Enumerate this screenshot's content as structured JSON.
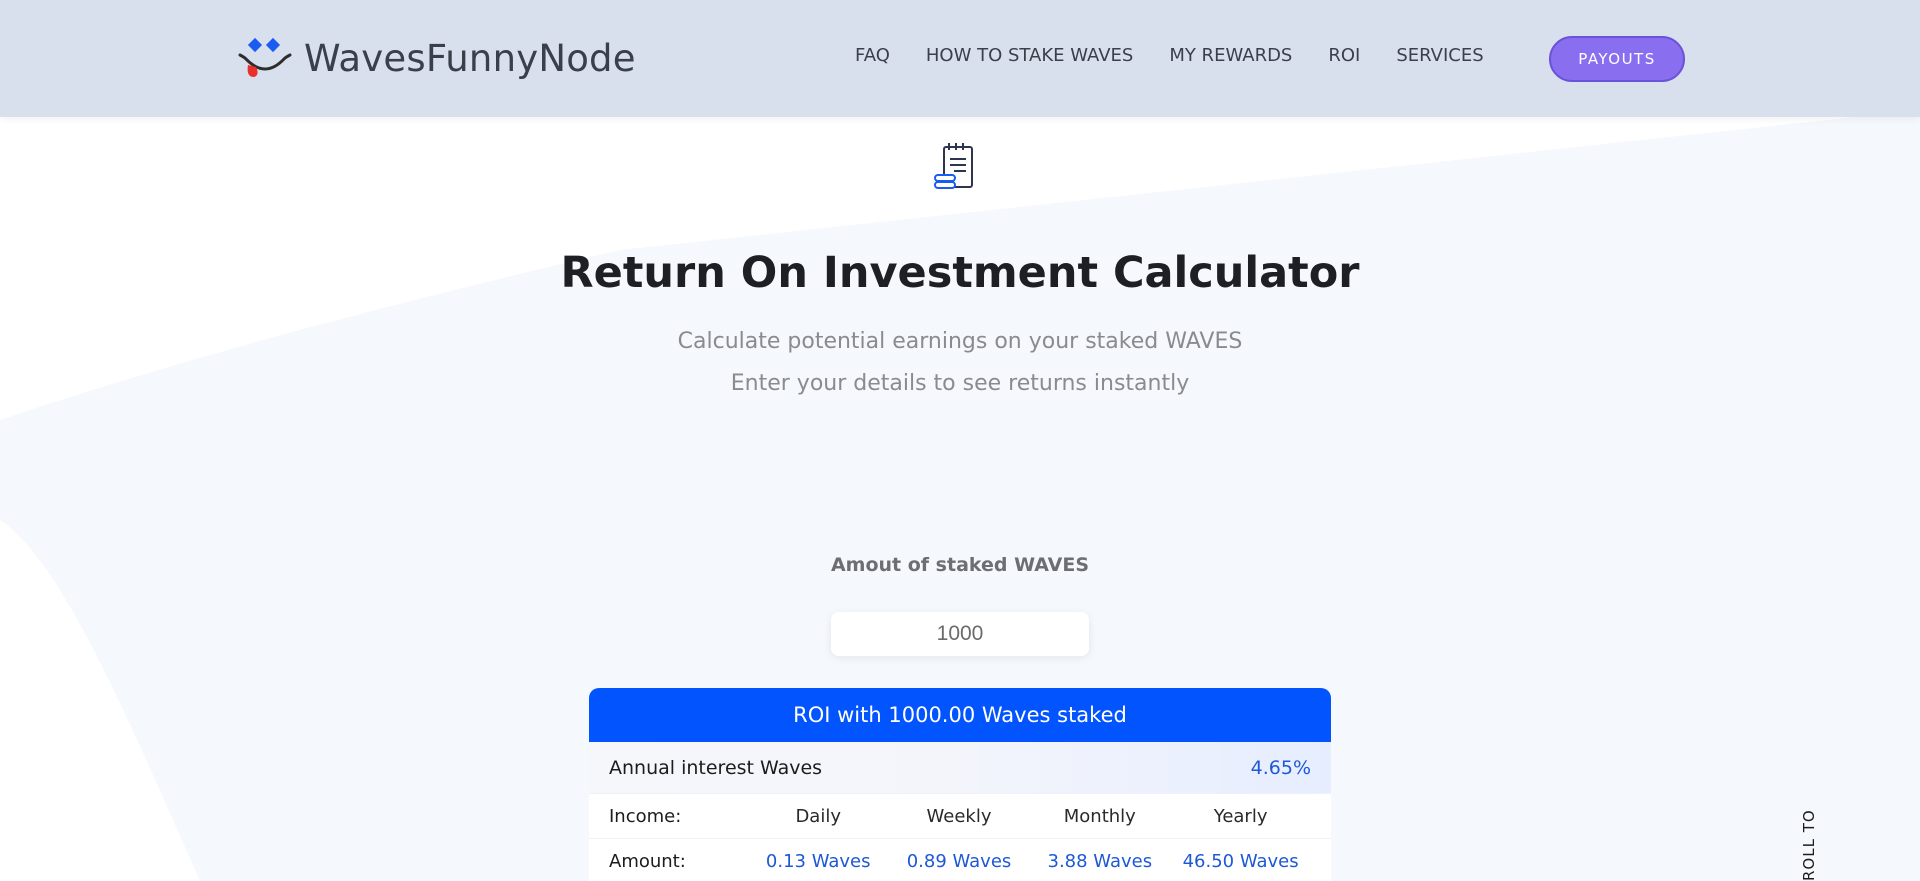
{
  "brand": {
    "name": "WavesFunnyNode",
    "logo_icon": "smiley-face-logo-icon"
  },
  "nav": {
    "items": [
      {
        "label": "FAQ"
      },
      {
        "label": "HOW TO STAKE WAVES"
      },
      {
        "label": "MY REWARDS"
      },
      {
        "label": "ROI"
      },
      {
        "label": "SERVICES"
      }
    ],
    "cta_label": "PAYOUTS"
  },
  "hero": {
    "icon": "calculator-notepad-icon",
    "title": "Return On Investment Calculator",
    "subtitle_1": "Calculate potential earnings on your staked WAVES",
    "subtitle_2": "Enter your details to see returns instantly"
  },
  "calculator": {
    "amount_label": "Amout of staked WAVES",
    "amount_value": "1000",
    "card_title": "ROI with 1000.00 Waves staked",
    "interest_label": "Annual interest Waves",
    "interest_value": "4.65%",
    "income_label": "Income:",
    "amount_row_label": "Amount:",
    "periods": [
      "Daily",
      "Weekly",
      "Monthly",
      "Yearly"
    ],
    "amounts": [
      "0.13 Waves",
      "0.89 Waves",
      "3.88 Waves",
      "46.50 Waves"
    ]
  },
  "scroll_top_label": "ROLL TOP",
  "colors": {
    "header_bg": "#d8e0ee",
    "accent_blue": "#0254ff",
    "value_blue": "#1d58d6",
    "cta_purple": "#8a6ef0"
  }
}
